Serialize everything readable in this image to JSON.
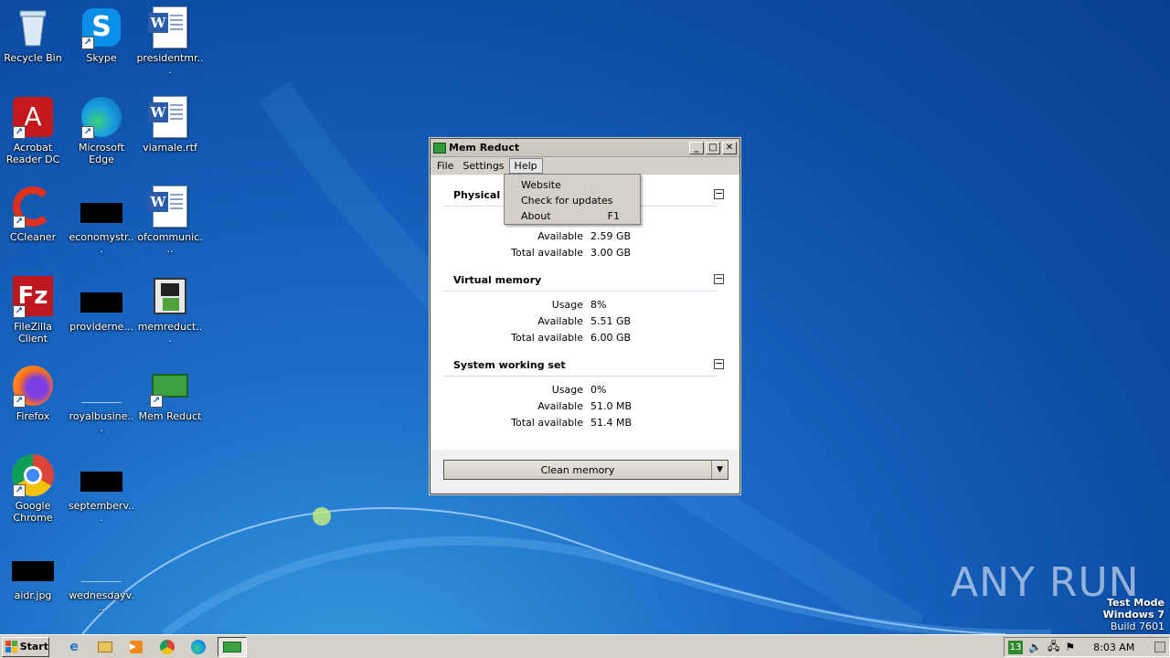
{
  "desktop": {
    "icons": [
      {
        "label": "Recycle Bin",
        "icon": "recycle-bin-icon"
      },
      {
        "label": "Skype",
        "icon": "skype-icon"
      },
      {
        "label": "presidentmr...",
        "icon": "word-document-icon"
      },
      {
        "label": "Acrobat Reader DC",
        "icon": "acrobat-icon"
      },
      {
        "label": "Microsoft Edge",
        "icon": "edge-icon"
      },
      {
        "label": "viamale.rtf",
        "icon": "word-document-icon"
      },
      {
        "label": "CCleaner",
        "icon": "ccleaner-icon"
      },
      {
        "label": "economystr...",
        "icon": "black-file-icon"
      },
      {
        "label": "ofcommunic...",
        "icon": "word-document-icon"
      },
      {
        "label": "FileZilla Client",
        "icon": "filezilla-icon"
      },
      {
        "label": "providerne...",
        "icon": "black-file-icon"
      },
      {
        "label": "memreduct...",
        "icon": "installer-icon"
      },
      {
        "label": "Firefox",
        "icon": "firefox-icon"
      },
      {
        "label": "royalbusine...",
        "icon": "blank-file-icon"
      },
      {
        "label": "Mem Reduct",
        "icon": "mem-reduct-icon"
      },
      {
        "label": "Google Chrome",
        "icon": "chrome-icon"
      },
      {
        "label": "septemberv...",
        "icon": "black-file-icon"
      },
      {
        "label": "aidr.jpg",
        "icon": "black-file-icon"
      },
      {
        "label": "wednesdayv...",
        "icon": "blank-file-icon"
      }
    ]
  },
  "window": {
    "title": "Mem Reduct",
    "menu": {
      "file": "File",
      "settings": "Settings",
      "help": "Help"
    },
    "help_menu": {
      "website": "Website",
      "check_updates": "Check for updates",
      "about": "About",
      "about_shortcut": "F1"
    },
    "sections": {
      "physical": {
        "title": "Physical memory",
        "rows": [
          {
            "key": "Available",
            "value": "2.59 GB"
          },
          {
            "key": "Total available",
            "value": "3.00 GB"
          }
        ]
      },
      "virtual": {
        "title": "Virtual memory",
        "rows": [
          {
            "key": "Usage",
            "value": "8%"
          },
          {
            "key": "Available",
            "value": "5.51 GB"
          },
          {
            "key": "Total available",
            "value": "6.00 GB"
          }
        ]
      },
      "system": {
        "title": "System working set",
        "rows": [
          {
            "key": "Usage",
            "value": "0%"
          },
          {
            "key": "Available",
            "value": "51.0 MB"
          },
          {
            "key": "Total available",
            "value": "51.4 MB"
          }
        ]
      }
    },
    "clean_button": "Clean memory"
  },
  "taskbar": {
    "start": "Start",
    "tray_badge": "13",
    "clock": "8:03 AM"
  },
  "watermark": {
    "line1": "Test Mode",
    "line2": "Windows 7",
    "line3": "Build 7601",
    "brand": "ANY RUN"
  }
}
